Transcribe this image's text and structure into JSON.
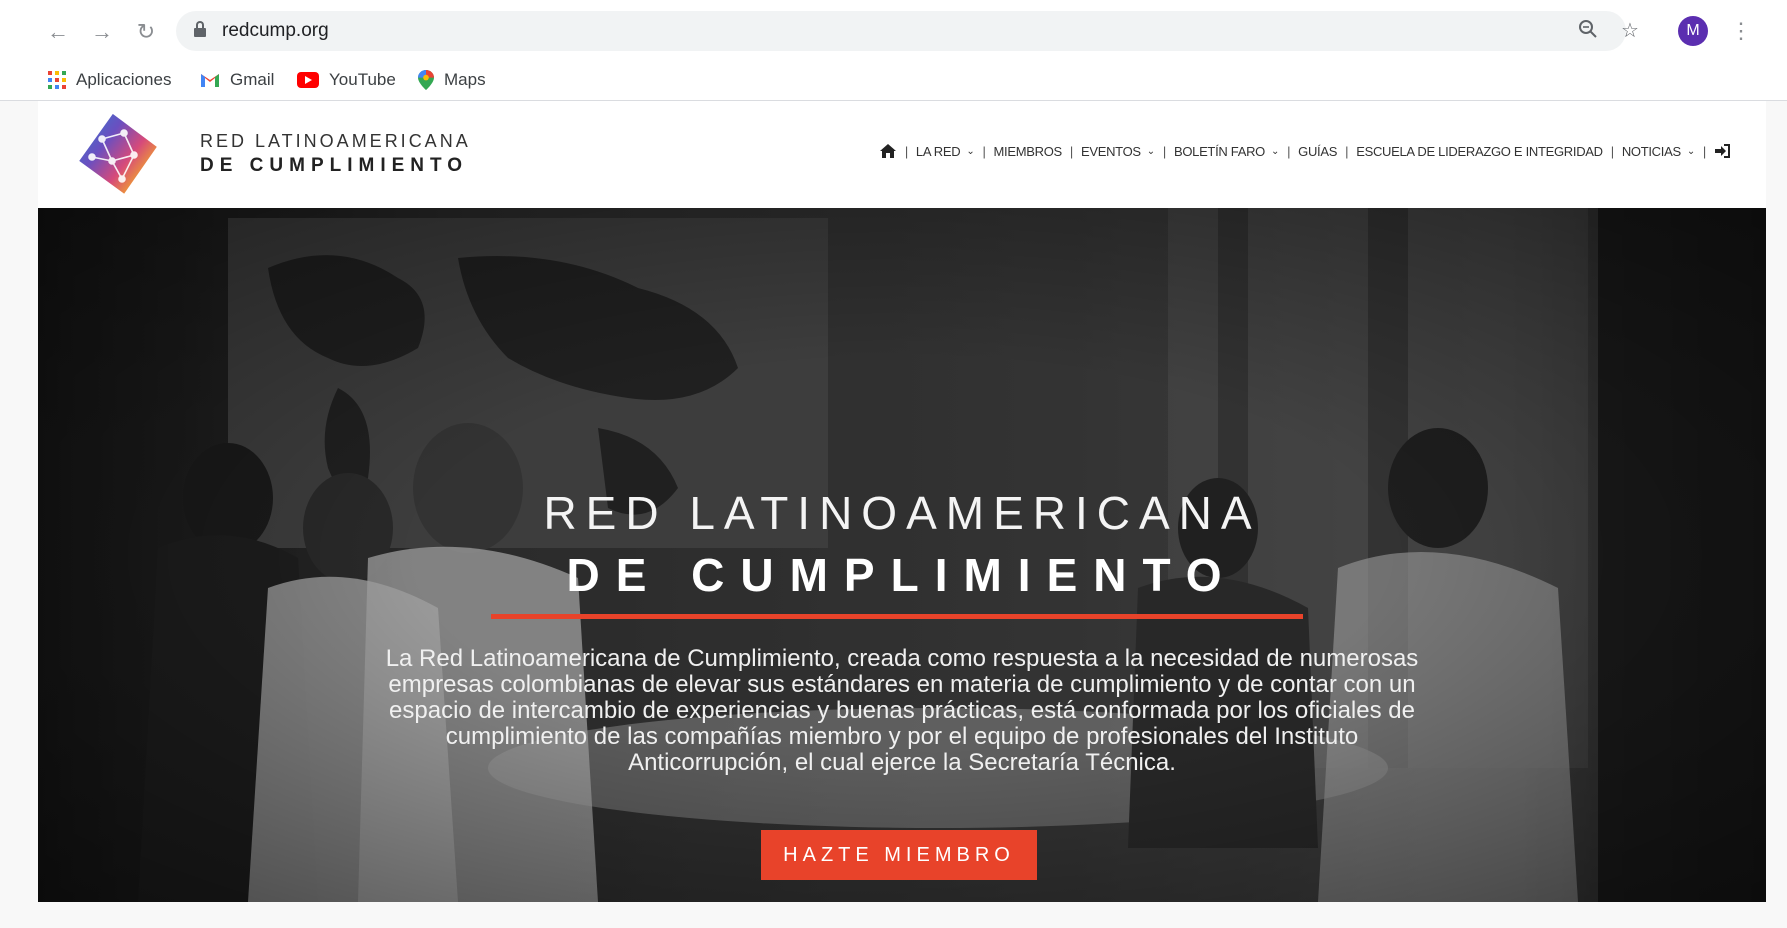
{
  "browser": {
    "url": "redcump.org",
    "avatar_letter": "M",
    "icons": {
      "back": "arrow-left-icon",
      "forward": "arrow-right-icon",
      "reload": "reload-icon",
      "lock": "lock-icon",
      "zoom": "zoom-icon",
      "star": "star-icon",
      "menu": "kebab-menu-icon"
    }
  },
  "bookmarks": [
    {
      "label": "Aplicaciones",
      "icon": "apps-grid-icon"
    },
    {
      "label": "Gmail",
      "icon": "gmail-icon"
    },
    {
      "label": "YouTube",
      "icon": "youtube-icon"
    },
    {
      "label": "Maps",
      "icon": "maps-icon"
    }
  ],
  "site": {
    "logo_line1": "RED LATINOAMERICANA",
    "logo_line2": "DE CUMPLIMIENTO",
    "nav": [
      {
        "label": "LA RED",
        "dropdown": true
      },
      {
        "label": "MIEMBROS",
        "dropdown": false
      },
      {
        "label": "EVENTOS",
        "dropdown": true
      },
      {
        "label": "BOLETÍN FARO",
        "dropdown": true
      },
      {
        "label": "GUÍAS",
        "dropdown": false
      },
      {
        "label": "ESCUELA DE LIDERAZGO E INTEGRIDAD",
        "dropdown": false
      },
      {
        "label": "NOTICIAS",
        "dropdown": true
      }
    ]
  },
  "hero": {
    "title_line1": "RED LATINOAMERICANA",
    "title_line2": "DE CUMPLIMIENTO",
    "description": "La Red Latinoamericana de Cumplimiento, creada como respuesta a la necesidad de numerosas empresas colombianas de elevar sus estándares en materia de cumplimiento y de contar con un espacio de intercambio de experiencias y buenas prácticas, está conformada por los oficiales de cumplimiento de las compañías miembro y por el equipo de profesionales del Instituto Anticorrupción, el cual ejerce la Secretaría Técnica.",
    "cta_label": "HAZTE MIEMBRO"
  },
  "colors": {
    "accent": "#e8432a",
    "avatar": "#5b2eb0"
  }
}
